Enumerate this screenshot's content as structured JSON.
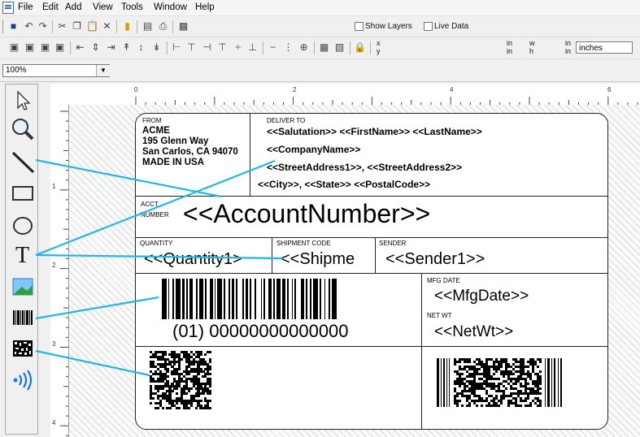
{
  "menu": [
    "File",
    "Edit",
    "Add",
    "View",
    "Tools",
    "Window",
    "Help"
  ],
  "toolbar": {
    "show_layers": "Show Layers",
    "live_data": "Live Data",
    "x_label": "x",
    "y_label": "y",
    "w_label": "w",
    "h_label": "h",
    "unit_in": "in",
    "units_value": "inches"
  },
  "zoom": {
    "value": "100%"
  },
  "ruler": {
    "h_ticks": [
      "0",
      "2",
      "4",
      "6"
    ],
    "v_ticks": [
      "1",
      "2",
      "3",
      "4"
    ]
  },
  "label": {
    "from_caption": "FROM",
    "from_lines": [
      "ACME",
      "195 Glenn Way",
      "San Carlos, CA 94070",
      "MADE IN USA"
    ],
    "deliver_caption": "DELIVER TO",
    "deliver_lines": [
      "<<Salutation>> <<FirstName>> <<LastName>>",
      "<<CompanyName>>",
      "<<StreetAddress1>>, <<StreetAddress2>>",
      "<<City>>, <<State>>  <<PostalCode>>"
    ],
    "acct_caption_1": "ACCT",
    "acct_caption_2": "NUMBER",
    "account_number": "<<AccountNumber>>",
    "quantity_caption": "QUANTITY",
    "quantity_value": "<<Quantity1>",
    "shipment_caption": "SHIPMENT CODE",
    "shipment_value": "<<Shipme",
    "sender_caption": "SENDER",
    "sender_value": "<<Sender1>>",
    "barcode_text": "(01) 00000000000000",
    "mfg_caption": "MFG DATE",
    "mfg_value": "<<MfgDate>>",
    "netwt_caption": "NET WT",
    "netwt_value": "<<NetWt>>"
  },
  "tools": [
    "pointer",
    "zoom",
    "line",
    "rectangle",
    "ellipse",
    "text",
    "image",
    "barcode",
    "2d-barcode",
    "rfid"
  ]
}
